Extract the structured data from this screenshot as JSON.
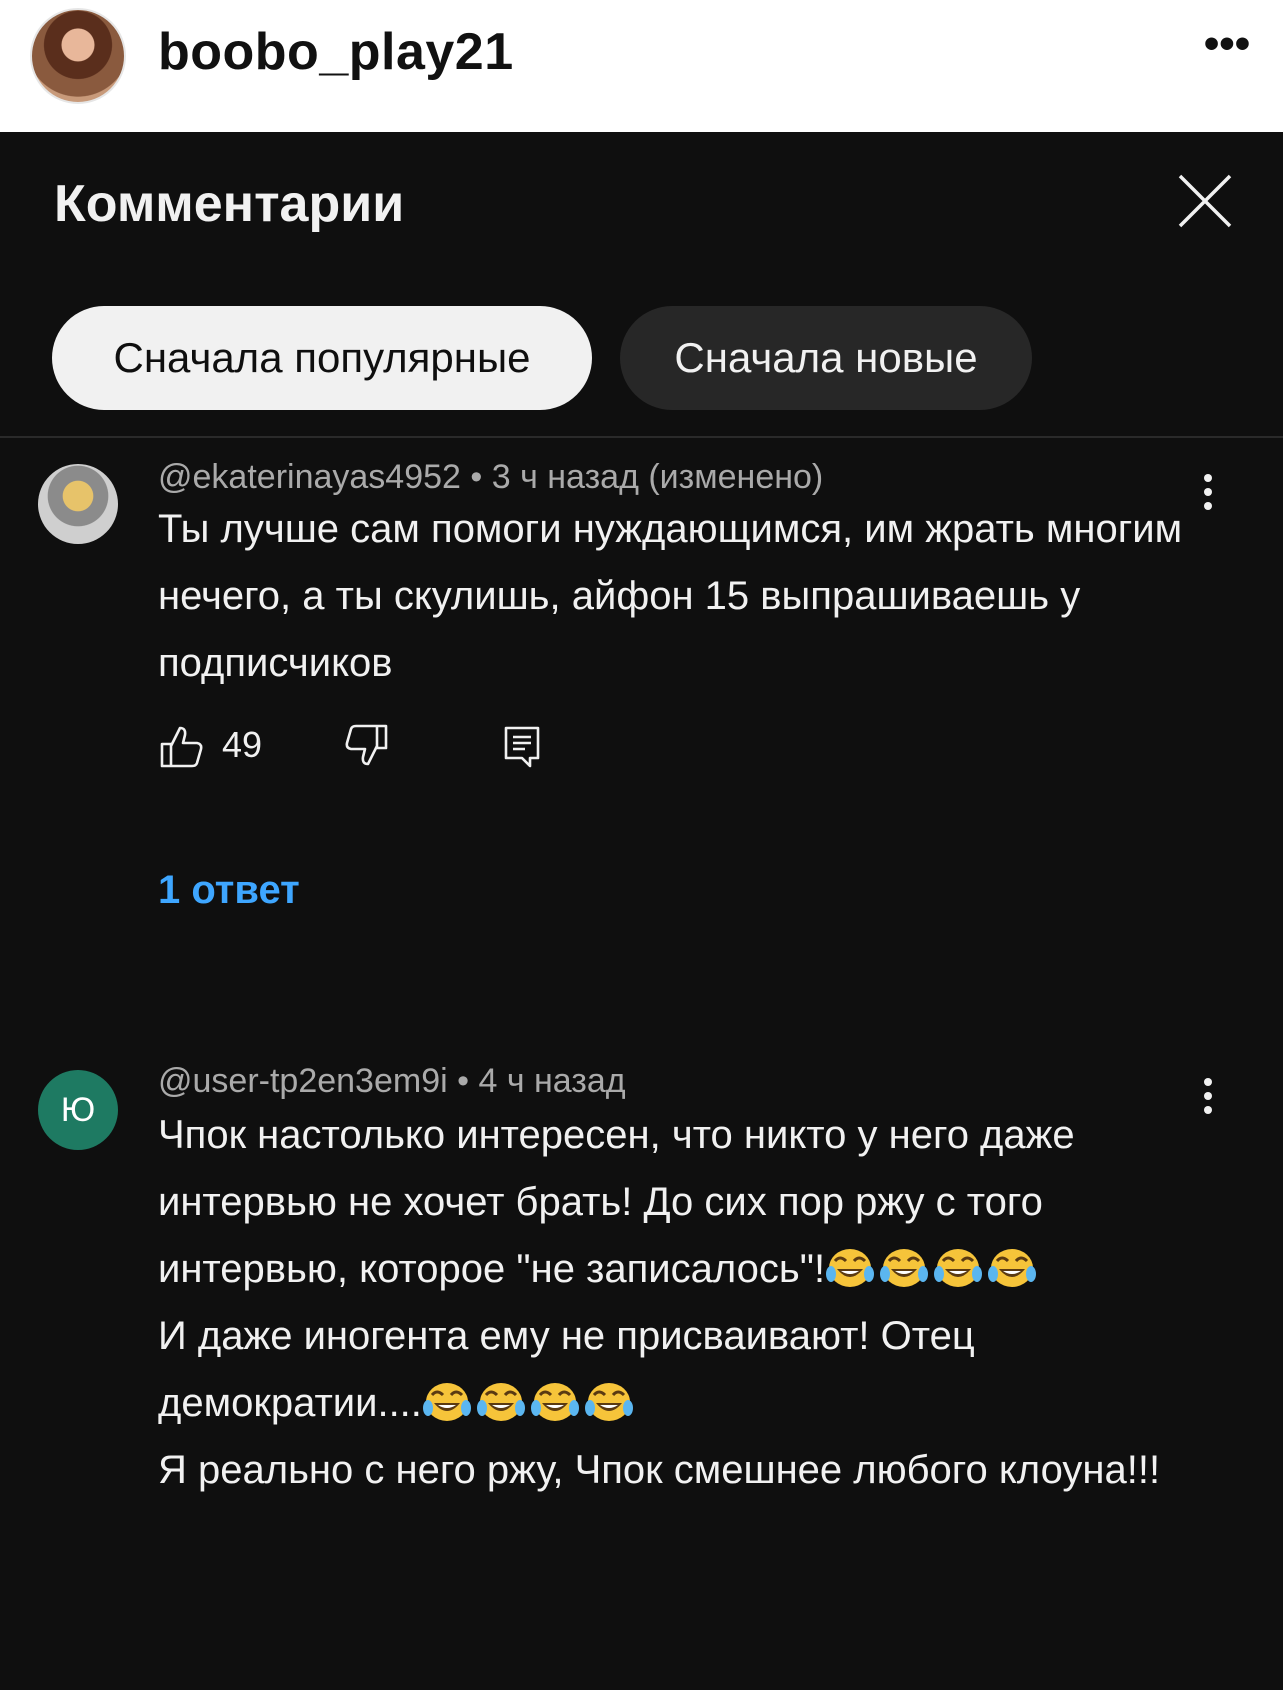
{
  "header": {
    "username": "boobo_play21",
    "more_glyph": "•••"
  },
  "panel": {
    "title": "Комментарии",
    "chips": [
      "Сначала популярные",
      "Сначала новые"
    ]
  },
  "comments": [
    {
      "author": "@ekaterinayas4952",
      "time": "3 ч назад (изменено)",
      "text": "Ты лучше сам помоги нуждающимся, им жрать многим нечего, а ты скулишь, айфон 15 выпрашиваешь у подписчиков",
      "likes": "49",
      "replies": "1 ответ"
    },
    {
      "author": "@user-tp2en3em9i",
      "avatar_letter": "Ю",
      "time": "4 ч назад",
      "lines": [
        "Чпок настолько интересен,  что никто у него даже интервью не хочет брать! До сих пор ржу с того интервью, которое \"не записалось\"!",
        "И даже иногента ему не присваивают! Отец демократии....",
        "Я реально с него ржу, Чпок смешнее любого клоуна!!!"
      ]
    }
  ],
  "icons": [
    "profile-avatar",
    "more-icon",
    "close-icon",
    "kebab-icon",
    "thumb-up-icon",
    "thumb-down-icon",
    "reply-icon",
    "laughing-emoji"
  ],
  "colors": {
    "panel_bg": "#0f0f0f",
    "link_blue": "#3ea6ff",
    "chip_active": "#f1f1f1",
    "chip_inactive": "#272727",
    "avatar_green": "#1e7a62"
  }
}
